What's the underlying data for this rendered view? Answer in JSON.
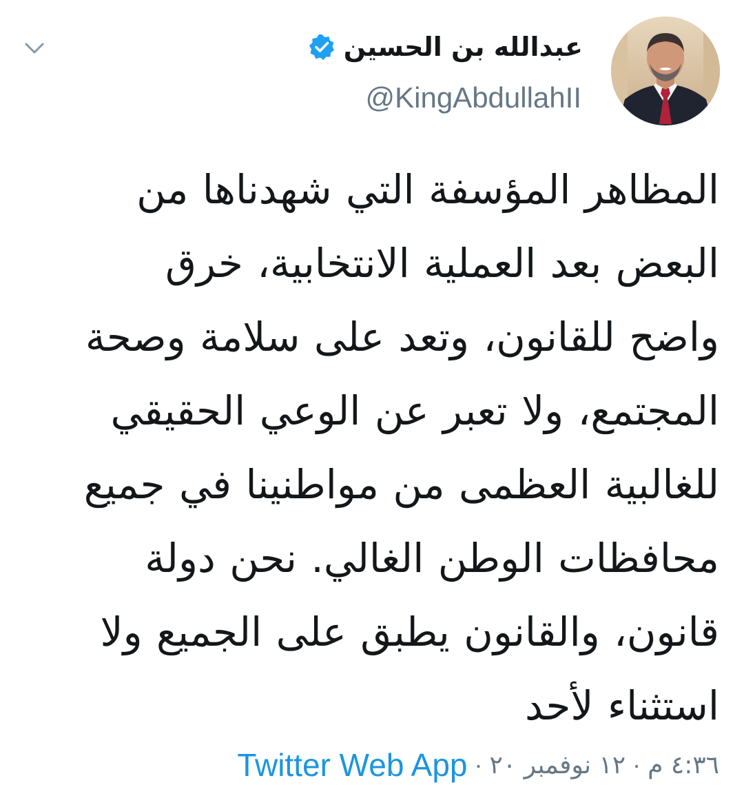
{
  "author": {
    "display_name": "عبدالله بن الحسين",
    "handle": "@KingAbdullahII",
    "verified_icon": "verified-badge",
    "avatar_icon": "profile-photo"
  },
  "menu": {
    "icon": "chevron-down-icon"
  },
  "tweet": {
    "text": "المظاهر المؤسفة التي شهدناها من\nالبعض بعد العملية الانتخابية، خرق\nواضح للقانون، وتعد على سلامة وصحة\nالمجتمع، ولا تعبر عن الوعي الحقيقي\nللغالبية العظمى من مواطنينا في جميع\nمحافظات الوطن الغالي. نحن دولة\nقانون، والقانون يطبق على الجميع ولا\nاستثناء لأحد"
  },
  "meta": {
    "time": "٤:٣٦ م",
    "date": "١٢ نوفمبر ٢٠",
    "separator": "·",
    "source": "Twitter Web App"
  },
  "colors": {
    "accent": "#1b95e0",
    "verified": "#1da1f2",
    "secondary_text": "#657786",
    "primary_text": "#14171a"
  }
}
